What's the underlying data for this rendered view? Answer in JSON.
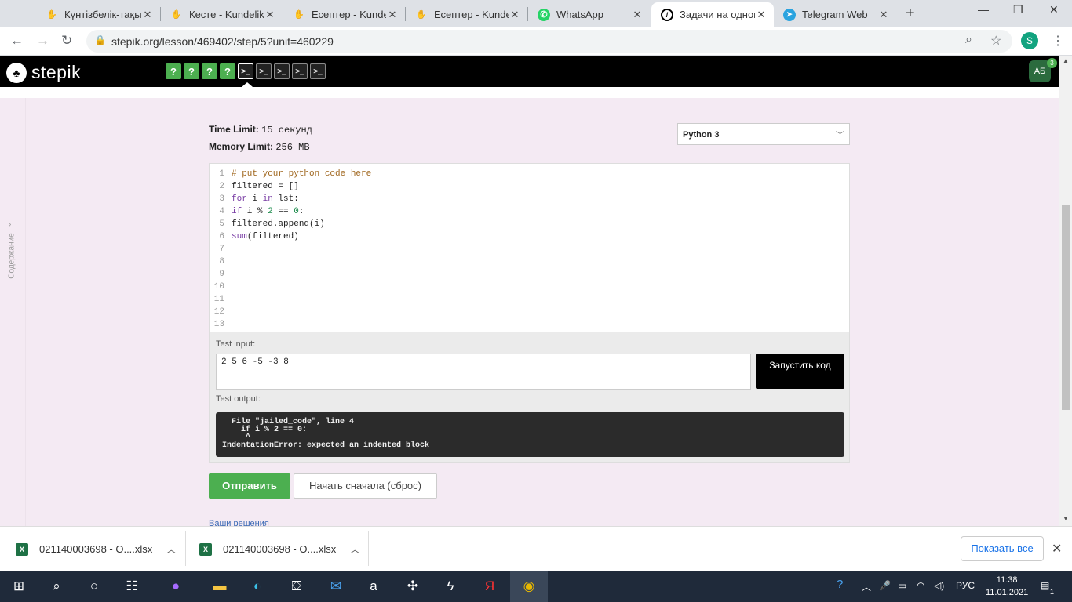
{
  "browser": {
    "tabs": [
      {
        "title": "Күнтізбелік-тақы",
        "icon": "sun-icon",
        "color": "#e5a000"
      },
      {
        "title": "Кесте - Kundelik.k",
        "icon": "hand-icon",
        "color": "#e5a000"
      },
      {
        "title": "Есептер - Kundelik",
        "icon": "hand-icon",
        "color": "#e5a000"
      },
      {
        "title": "Есептер - Kundelik",
        "icon": "hand-icon",
        "color": "#e5a000"
      },
      {
        "title": "WhatsApp",
        "icon": "whatsapp-icon",
        "color": "#25d366"
      },
      {
        "title": "Задачи на одном",
        "icon": "stepik-icon",
        "color": "#000000"
      },
      {
        "title": "Telegram Web",
        "icon": "telegram-icon",
        "color": "#2aa3df"
      }
    ],
    "active_tab": 5,
    "url": "stepik.org/lesson/469402/step/5?unit=460229",
    "profile_letter": "S"
  },
  "stepik": {
    "logo_text": "stepik",
    "steps": [
      "?",
      "?",
      "?",
      "?",
      ">_",
      ">_",
      ">_",
      ">_",
      ">_"
    ],
    "avatar_initials": "АБ",
    "notification_count": "3",
    "sidebar_label": "Содержание"
  },
  "problem": {
    "time_limit_label": "Time Limit:",
    "time_limit_value": "15 секунд",
    "memory_limit_label": "Memory Limit:",
    "memory_limit_value": "256 MB",
    "language": "Python 3",
    "code_lines": [
      "# put your python code here",
      "filtered = []",
      "for i in lst:",
      "if i % 2 == 0:",
      "filtered.append(i)",
      "sum(filtered)",
      "",
      "",
      "",
      "",
      "",
      "",
      ""
    ],
    "test_input_label": "Test input:",
    "test_input_value": "2 5 6 -5 -3 8",
    "run_button": "Запустить код",
    "test_output_label": "Test output:",
    "test_output": "  File \"jailed_code\", line 4\n    if i % 2 == 0:\n     ^\nIndentationError: expected an indented block",
    "submit_button": "Отправить",
    "reset_button": "Начать сначала (сброс)",
    "solutions_link": "Ваши решения"
  },
  "downloads": {
    "items": [
      {
        "name": "021140003698 - O....xlsx"
      },
      {
        "name": "021140003698 - O....xlsx"
      }
    ],
    "show_all": "Показать все"
  },
  "taskbar": {
    "language": "РУС",
    "time": "11:38",
    "date": "11.01.2021",
    "notification_count": "1"
  }
}
